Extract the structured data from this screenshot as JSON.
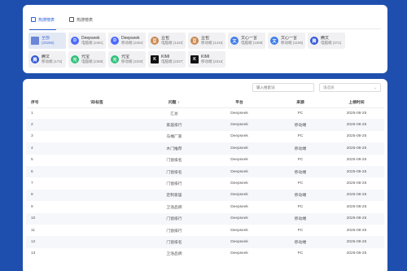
{
  "tabs": [
    {
      "label": "热搜榜表",
      "active": true,
      "icon": "hot-list-icon"
    },
    {
      "label": "热搜榜表",
      "active": false,
      "icon": "document-icon"
    }
  ],
  "platforms": [
    {
      "name": "全部",
      "sub": "(20266)",
      "color": "#6b86d8",
      "selected": true,
      "icon": "doc-icon",
      "square": true,
      "glyph": ""
    },
    {
      "name": "Deepseek",
      "sub": "电脑端 (2461)",
      "color": "#4d6bfe",
      "icon": "deepseek-icon",
      "glyph": "D"
    },
    {
      "name": "Deepseek",
      "sub": "移动端 (2464)",
      "color": "#4d6bfe",
      "icon": "deepseek-icon",
      "glyph": "D"
    },
    {
      "name": "豆包",
      "sub": "电脑端 (1423)",
      "color": "#c9864e",
      "icon": "doubao-icon",
      "glyph": "豆"
    },
    {
      "name": "豆包",
      "sub": "移动端 (1415)",
      "color": "#c9864e",
      "icon": "doubao-icon",
      "glyph": "豆"
    },
    {
      "name": "文心一言",
      "sub": "电脑端 (1069)",
      "color": "#3f7ee8",
      "icon": "wenxin-icon",
      "glyph": "文"
    },
    {
      "name": "文心一言",
      "sub": "移动端 (1106)",
      "color": "#3f7ee8",
      "icon": "wenxin-icon",
      "glyph": "文"
    },
    {
      "name": "",
      "sub": "",
      "color": "",
      "icon": "",
      "glyph": "",
      "empty": true
    },
    {
      "name": "腾文",
      "sub": "电脑端 (371)",
      "color": "#3357d6",
      "icon": "tengwen-icon",
      "glyph": "腾"
    },
    {
      "name": "腾文",
      "sub": "移动端 (173)",
      "color": "#3357d6",
      "icon": "tengwen-icon",
      "glyph": "腾"
    },
    {
      "name": "元宝",
      "sub": "电脑端 (2385)",
      "color": "#2fbf7a",
      "icon": "yuanbao-icon",
      "glyph": "元"
    },
    {
      "name": "元宝",
      "sub": "移动端 (2330)",
      "color": "#2fbf7a",
      "icon": "yuanbao-icon",
      "glyph": "元"
    },
    {
      "name": "KIMI",
      "sub": "电脑端 (2327)",
      "color": "#111111",
      "icon": "kimi-icon",
      "glyph": "K",
      "square": true
    },
    {
      "name": "KIMI",
      "sub": "移动端 (2316)",
      "color": "#111111",
      "icon": "kimi-icon",
      "glyph": "K",
      "square": true
    }
  ],
  "filters": {
    "keyword_placeholder": "输入搜索词",
    "select_placeholder": "请选择"
  },
  "table": {
    "headers": {
      "index": "序号",
      "keyword": "词/标签",
      "question": "问题",
      "platform": "平台",
      "source": "来源",
      "time": "上榜时间"
    },
    "rows": [
      {
        "index": "1",
        "keyword": "",
        "question": "汇总",
        "platform": "Deepseek",
        "source": "PC",
        "time": "2025-08-25"
      },
      {
        "index": "2",
        "keyword": "",
        "question": "家居排行",
        "platform": "Deepseek",
        "source": "移动端",
        "time": "2025-08-25"
      },
      {
        "index": "3",
        "keyword": "",
        "question": "马桶厂家",
        "platform": "Deepseek",
        "source": "PC",
        "time": "2025-08-25"
      },
      {
        "index": "4",
        "keyword": "",
        "question": "木门推荐",
        "platform": "Deepseek",
        "source": "移动端",
        "time": "2025-08-25"
      },
      {
        "index": "5",
        "keyword": "",
        "question": "门窗排名",
        "platform": "Deepseek",
        "source": "PC",
        "time": "2025-08-25"
      },
      {
        "index": "6",
        "keyword": "",
        "question": "门窗排名",
        "platform": "Deepseek",
        "source": "移动端",
        "time": "2025-08-25"
      },
      {
        "index": "7",
        "keyword": "",
        "question": "门窗排行",
        "platform": "Deepseek",
        "source": "PC",
        "time": "2025-08-25"
      },
      {
        "index": "8",
        "keyword": "",
        "question": "定制家居",
        "platform": "Deepseek",
        "source": "移动端",
        "time": "2025-08-25"
      },
      {
        "index": "9",
        "keyword": "",
        "question": "卫浴品牌",
        "platform": "Deepseek",
        "source": "PC",
        "time": "2025-08-25"
      },
      {
        "index": "10",
        "keyword": "",
        "question": "门窗排行",
        "platform": "Deepseek",
        "source": "移动端",
        "time": "2025-08-25"
      },
      {
        "index": "11",
        "keyword": "",
        "question": "门窗排行",
        "platform": "Deepseek",
        "source": "PC",
        "time": "2025-08-25"
      },
      {
        "index": "12",
        "keyword": "",
        "question": "门窗排名",
        "platform": "Deepseek",
        "source": "移动端",
        "time": "2025-08-25"
      },
      {
        "index": "13",
        "keyword": "",
        "question": "卫浴品牌",
        "platform": "Deepseek",
        "source": "PC",
        "time": "2025-08-25"
      }
    ]
  },
  "colors": {
    "accent": "#2b63d9",
    "background": "#1f4fae"
  }
}
